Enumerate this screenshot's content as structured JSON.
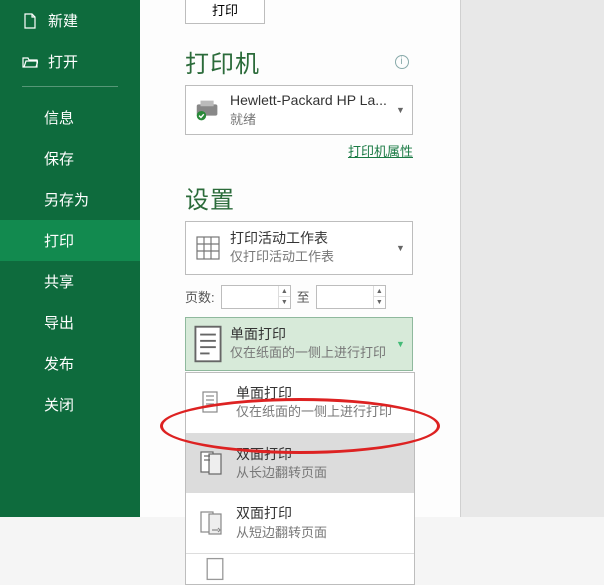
{
  "sidebar": {
    "items": [
      {
        "label": "新建"
      },
      {
        "label": "打开"
      },
      {
        "label": "信息"
      },
      {
        "label": "保存"
      },
      {
        "label": "另存为"
      },
      {
        "label": "打印"
      },
      {
        "label": "共享"
      },
      {
        "label": "导出"
      },
      {
        "label": "发布"
      },
      {
        "label": "关闭"
      }
    ]
  },
  "print": {
    "big_button": "打印",
    "printer_heading": "打印机",
    "printer_name": "Hewlett-Packard HP La...",
    "printer_status": "就绪",
    "printer_props_link": "打印机属性",
    "settings_heading": "设置",
    "settings_primary": "打印活动工作表",
    "settings_secondary": "仅打印活动工作表",
    "pages_label": "页数:",
    "pages_to": "至",
    "pages_from_value": "",
    "pages_to_value": "",
    "duplex_selected_primary": "单面打印",
    "duplex_selected_secondary": "仅在纸面的一侧上进行打印",
    "duplex_options": [
      {
        "primary": "单面打印",
        "secondary": "仅在纸面的一侧上进行打印"
      },
      {
        "primary": "双面打印",
        "secondary": "从长边翻转页面"
      },
      {
        "primary": "双面打印",
        "secondary": "从短边翻转页面"
      }
    ]
  }
}
